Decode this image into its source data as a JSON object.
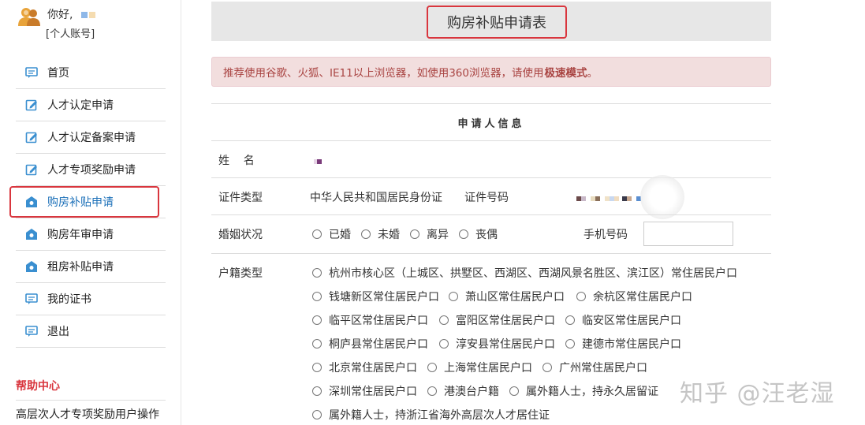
{
  "user": {
    "greeting": "你好,",
    "account_label": "[个人账号]"
  },
  "sidebar": {
    "items": [
      {
        "label": "首页",
        "icon": "comment-icon"
      },
      {
        "label": "人才认定申请",
        "icon": "edit-icon"
      },
      {
        "label": "人才认定备案申请",
        "icon": "edit-icon"
      },
      {
        "label": "人才专项奖励申请",
        "icon": "edit-icon"
      },
      {
        "label": "购房补贴申请",
        "icon": "home-icon",
        "active": true
      },
      {
        "label": "购房年审申请",
        "icon": "home-icon"
      },
      {
        "label": "租房补贴申请",
        "icon": "home-icon"
      },
      {
        "label": "我的证书",
        "icon": "comment-icon"
      },
      {
        "label": "退出",
        "icon": "comment-icon"
      }
    ],
    "help_title": "帮助中心",
    "help_item": "高层次人才专项奖励用户操作"
  },
  "page": {
    "title": "购房补贴申请表",
    "alert_text": "推荐使用谷歌、火狐、IE11以上浏览器，如使用360浏览器，请使用",
    "alert_bold": "极速模式",
    "alert_end": "。"
  },
  "form": {
    "section_title": "申请人信息",
    "name_label": "姓    名",
    "id_type_label": "证件类型",
    "id_type_value": "中华人民共和国居民身份证",
    "id_number_label": "证件号码",
    "marital_label": "婚姻状况",
    "marital_options": [
      "已婚",
      "未婚",
      "离异",
      "丧偶"
    ],
    "phone_label": "手机号码",
    "phone_value": "",
    "hukou_label": "户籍类型",
    "hukou_options": [
      "杭州市核心区（上城区、拱墅区、西湖区、西湖风景名胜区、滨江区）常住居民户口",
      "钱塘新区常住居民户口",
      "萧山区常住居民户口",
      "余杭区常住居民户口",
      "临平区常住居民户口",
      "富阳区常住居民户口",
      "临安区常住居民户口",
      "桐庐县常住居民户口",
      "淳安县常住居民户口",
      "建德市常住居民户口",
      "北京常住居民户口",
      "上海常住居民户口",
      "广州常住居民户口",
      "深圳常住居民户口",
      "港澳台户籍",
      "属外籍人士，持永久居留证",
      "属外籍人士，持浙江省海外高层次人才居住证"
    ]
  },
  "watermark": "知乎 @汪老湿",
  "colors": {
    "highlight": "#d9363e",
    "alert_bg": "#f2dede",
    "alert_text": "#a94442",
    "link_blue": "#1a6fb8",
    "icon_blue": "#3a8fd0"
  }
}
